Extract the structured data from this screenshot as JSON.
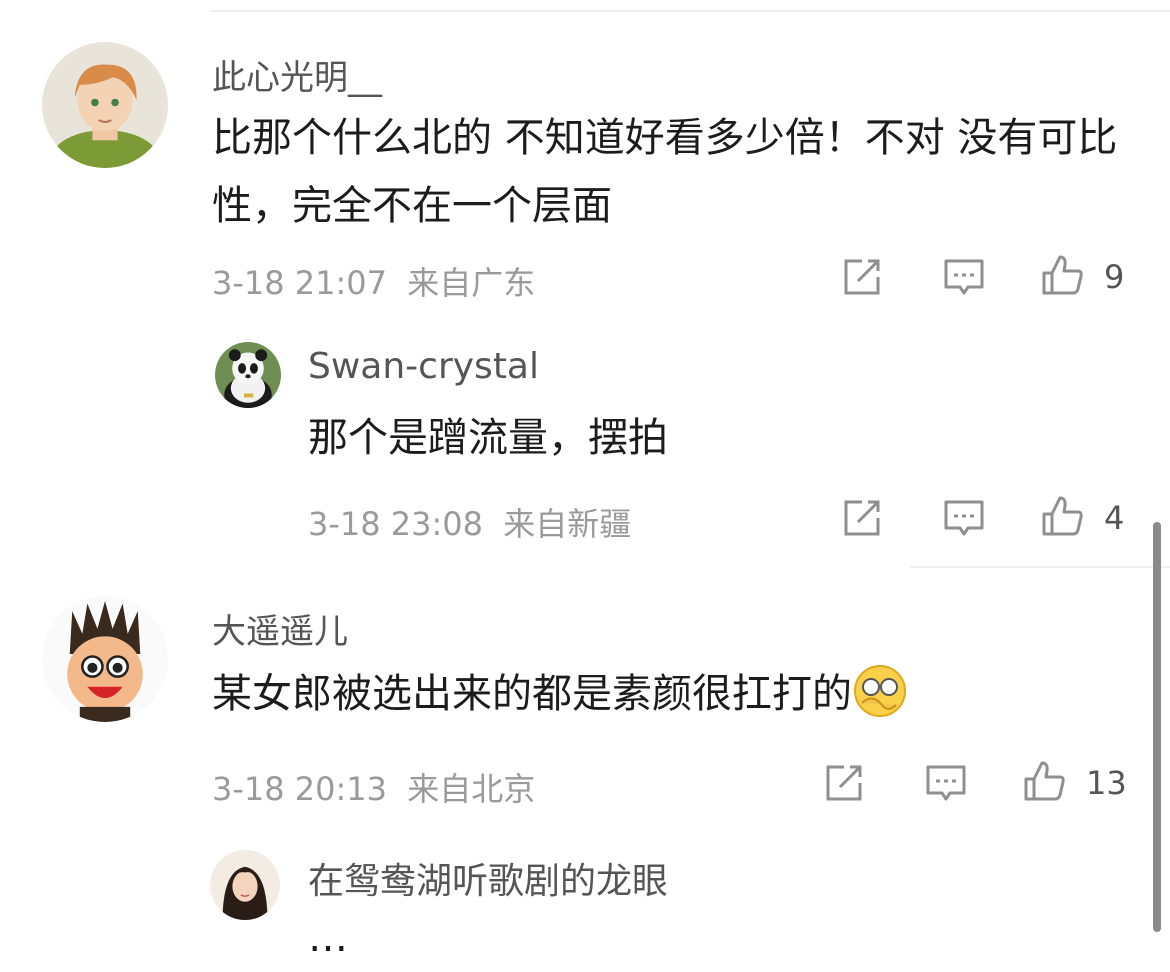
{
  "comments": [
    {
      "user": "此心光明__",
      "text": "比那个什么北的 不知道好看多少倍！不对 没有可比性，完全不在一个层面",
      "time": "3-18 21:07",
      "location": "来自广东",
      "likes": "9",
      "reply": {
        "user": "Swan-crystal",
        "text": "那个是蹭流量，摆拍",
        "time": "3-18 23:08",
        "location": "来自新疆",
        "likes": "4"
      }
    },
    {
      "user": "大遥遥儿",
      "text": "某女郎被选出来的都是素颜很扛打的",
      "time": "3-18 20:13",
      "location": "来自北京",
      "likes": "13",
      "reply": {
        "user": "在鸳鸯湖听歌剧的龙眼",
        "text": "…"
      }
    }
  ],
  "icons": {
    "share": "share-icon",
    "comment": "comment-icon",
    "like": "thumbs-up-icon",
    "emoji": "emoji-covering-face-icon"
  },
  "colors": {
    "meta": "#9a9a9a",
    "icon": "#8f8f8f",
    "username": "#555555"
  }
}
